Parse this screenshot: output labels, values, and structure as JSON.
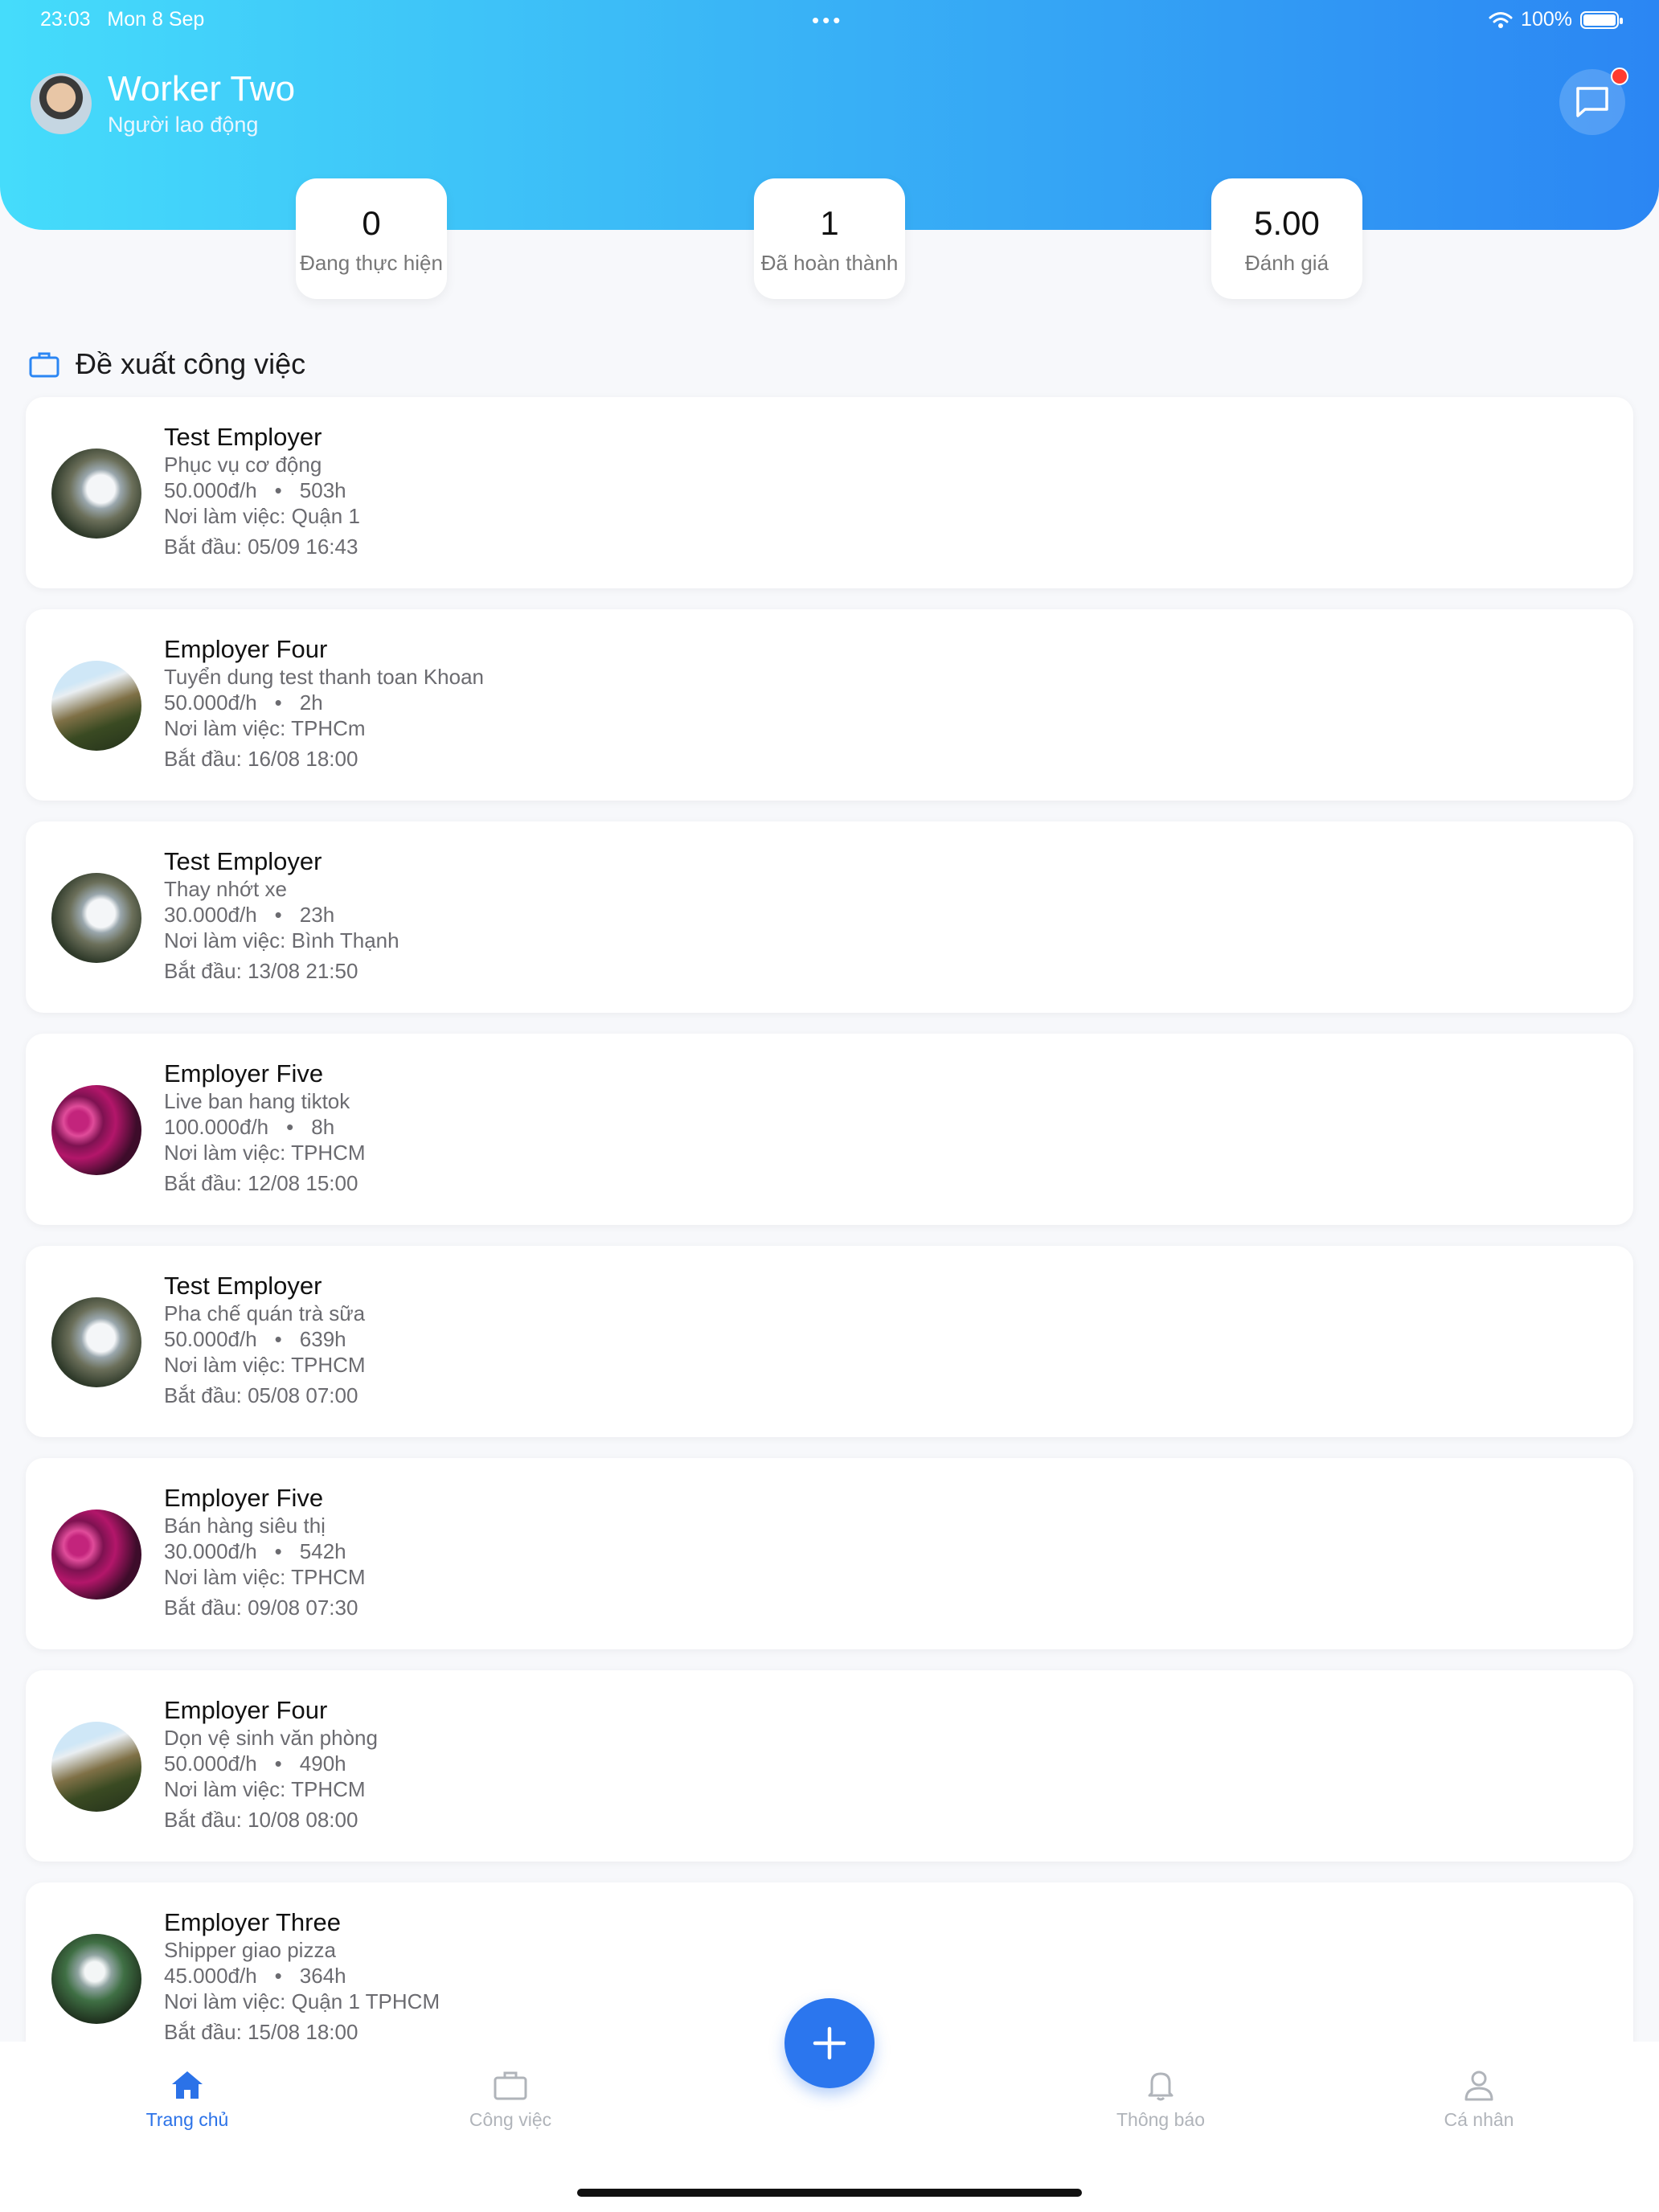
{
  "status_bar": {
    "time": "23:03",
    "date": "Mon 8 Sep",
    "dots": "•••",
    "battery": "100%"
  },
  "profile": {
    "name": "Worker Two",
    "role": "Người lao động"
  },
  "stats": [
    {
      "value": "0",
      "label": "Đang thực hiện"
    },
    {
      "value": "1",
      "label": "Đã hoàn thành"
    },
    {
      "value": "5.00",
      "label": "Đánh giá"
    }
  ],
  "section": {
    "title": "Đề xuất công việc"
  },
  "jobs": [
    {
      "employer": "Test Employer",
      "title": "Phục vụ cơ động",
      "rate": "50.000đ/h",
      "duration": "503h",
      "location": "Nơi làm việc: Quận 1",
      "start": "Bắt đầu: 05/09 16:43",
      "thumb": "waterfall-a"
    },
    {
      "employer": "Employer Four",
      "title": "Tuyển dung test thanh toan Khoan",
      "rate": "50.000đ/h",
      "duration": "2h",
      "location": "Nơi làm việc: TPHCm",
      "start": "Bắt đầu: 16/08 18:00",
      "thumb": "waterfall-b"
    },
    {
      "employer": "Test Employer",
      "title": "Thay nhớt xe",
      "rate": "30.000đ/h",
      "duration": "23h",
      "location": "Nơi làm việc: Bình Thạnh",
      "start": "Bắt đầu: 13/08 21:50",
      "thumb": "waterfall-a"
    },
    {
      "employer": "Employer Five",
      "title": "Live ban hang tiktok",
      "rate": "100.000đ/h",
      "duration": "8h",
      "location": "Nơi làm việc: TPHCM",
      "start": "Bắt đầu: 12/08 15:00",
      "thumb": "flowers"
    },
    {
      "employer": "Test Employer",
      "title": "Pha chế quán trà sữa",
      "rate": "50.000đ/h",
      "duration": "639h",
      "location": "Nơi làm việc: TPHCM",
      "start": "Bắt đầu: 05/08 07:00",
      "thumb": "waterfall-a"
    },
    {
      "employer": "Employer Five",
      "title": "Bán hàng siêu thị",
      "rate": "30.000đ/h",
      "duration": "542h",
      "location": "Nơi làm việc: TPHCM",
      "start": "Bắt đầu: 09/08 07:30",
      "thumb": "flowers"
    },
    {
      "employer": "Employer Four",
      "title": "Dọn vệ sinh văn phòng",
      "rate": "50.000đ/h",
      "duration": "490h",
      "location": "Nơi làm việc: TPHCM",
      "start": "Bắt đầu: 10/08 08:00",
      "thumb": "waterfall-b"
    },
    {
      "employer": "Employer Three",
      "title": "Shipper giao pizza",
      "rate": "45.000đ/h",
      "duration": "364h",
      "location": "Nơi làm việc: Quận 1 TPHCM",
      "start": "Bắt đầu: 15/08 18:00",
      "thumb": "waterfall-c"
    }
  ],
  "bullet": "•",
  "tabs": [
    {
      "label": "Trang chủ",
      "icon": "home-icon",
      "active": true
    },
    {
      "label": "Công việc",
      "icon": "briefcase-icon",
      "active": false
    },
    {
      "label": "Thông báo",
      "icon": "bell-icon",
      "active": false
    },
    {
      "label": "Cá nhân",
      "icon": "person-icon",
      "active": false
    }
  ],
  "colors": {
    "accent": "#2b76ee",
    "header_start": "#45dcfb",
    "header_end": "#2b86f3",
    "notification_dot": "#ff3b30"
  }
}
